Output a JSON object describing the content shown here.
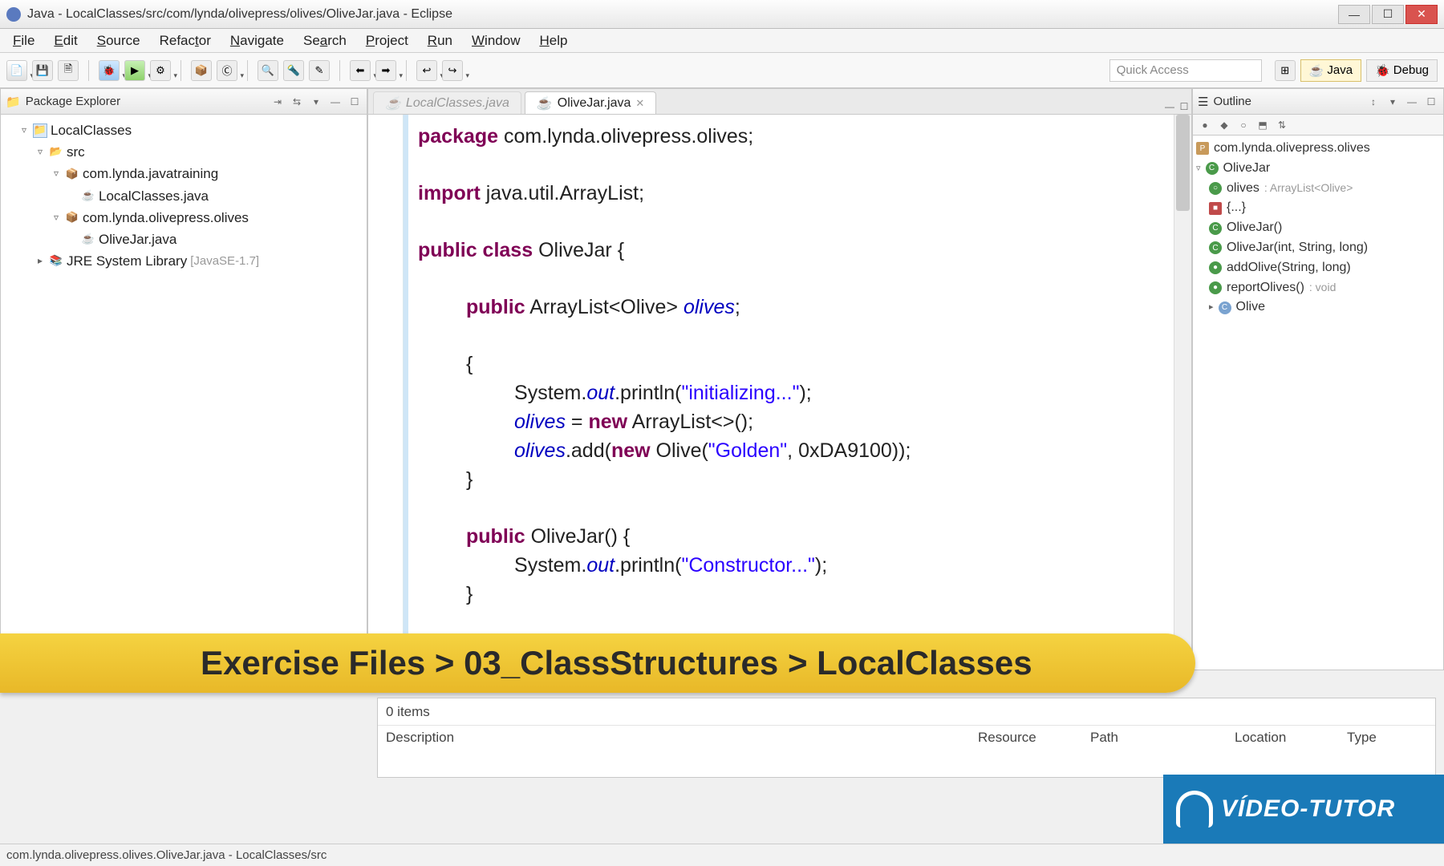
{
  "titlebar": {
    "text": "Java - LocalClasses/src/com/lynda/olivepress/olives/OliveJar.java - Eclipse"
  },
  "menu": {
    "file": "File",
    "edit": "Edit",
    "source": "Source",
    "refactor": "Refactor",
    "navigate": "Navigate",
    "search": "Search",
    "project": "Project",
    "run": "Run",
    "window": "Window",
    "help": "Help"
  },
  "toolbar": {
    "quick_access_placeholder": "Quick Access",
    "persp_java": "Java",
    "persp_debug": "Debug"
  },
  "package_explorer": {
    "title": "Package Explorer",
    "project": "LocalClasses",
    "src": "src",
    "pkg1": "com.lynda.javatraining",
    "file1": "LocalClasses.java",
    "pkg2": "com.lynda.olivepress.olives",
    "file2": "OliveJar.java",
    "jre": "JRE System Library",
    "jre_hint": "[JavaSE-1.7]"
  },
  "editor": {
    "tab_inactive": "LocalClasses.java",
    "tab_active": "OliveJar.java",
    "code": {
      "l1a": "package",
      "l1b": " com.lynda.olivepress.olives;",
      "l2a": "import",
      "l2b": " java.util.ArrayList;",
      "l3a": "public class",
      "l3b": " OliveJar {",
      "l4a": "public",
      "l4b": " ArrayList<Olive> ",
      "l4c": "olives",
      "l4d": ";",
      "l5": "{",
      "l6a": "System.",
      "l6b": "out",
      "l6c": ".println(",
      "l6d": "\"initializing...\"",
      "l6e": ");",
      "l7a": "olives",
      "l7b": " = ",
      "l7c": "new",
      "l7d": " ArrayList<>();",
      "l8a": "olives",
      "l8b": ".add(",
      "l8c": "new",
      "l8d": " Olive(",
      "l8e": "\"Golden\"",
      "l8f": ", 0xDA9100));",
      "l9": "}",
      "l10a": "public",
      "l10b": " OliveJar() {",
      "l11a": "System.",
      "l11b": "out",
      "l11c": ".println(",
      "l11d": "\"Constructor...\"",
      "l11e": ");",
      "l12": "}"
    }
  },
  "outline": {
    "title": "Outline",
    "pkg": "com.lynda.olivepress.olives",
    "cls": "OliveJar",
    "field": "olives",
    "field_type": ": ArrayList<Olive>",
    "init": "{...}",
    "ctor1": "OliveJar()",
    "ctor2": "OliveJar(int, String, long)",
    "meth1": "addOlive(String, long)",
    "meth2": "reportOlives()",
    "meth2_type": ": void",
    "nested": "Olive"
  },
  "banner": {
    "text": "Exercise Files > 03_ClassStructures > LocalClasses"
  },
  "problems": {
    "items": "0 items",
    "cols": {
      "desc": "Description",
      "resource": "Resource",
      "path": "Path",
      "location": "Location",
      "type": "Type"
    }
  },
  "statusbar": {
    "text": "com.lynda.olivepress.olives.OliveJar.java - LocalClasses/src"
  },
  "video_badge": {
    "text": "VÍDEO-TUTOR"
  }
}
